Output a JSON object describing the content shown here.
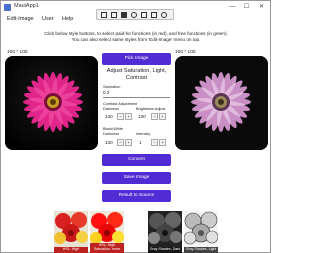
{
  "window": {
    "title": "MauiApp1",
    "controls": {
      "minimize": "—",
      "maximize": "☐",
      "close": "✕"
    }
  },
  "menu": [
    "Edit-Image",
    "User",
    "Help"
  ],
  "toolbar": {
    "icons": [
      "select-icon",
      "window-icon",
      "pointer-icon",
      "record-icon",
      "grid-icon",
      "inspect-icon",
      "settings-icon"
    ]
  },
  "instructions": "Click below style buttons, to select paid-for functions (in red), and free functions (in green). You can also select same styles from 'Edit-Image' menu on top.",
  "images": {
    "left_label": "100 * 100",
    "right_label": "100 * 100"
  },
  "controls": {
    "pick_image": "Pick Image",
    "heading": "Adjust Saturation, Light, Contrast",
    "saturation_label": "Saturation",
    "saturation_value": "0.2",
    "contrast_section": "Contrast Adjustment",
    "darkness_label": "Darkness",
    "brightness_label": "Brightness Adjust",
    "darkness_value": "130",
    "darkness_minus": "−",
    "darkness_plus": "+",
    "brightness_value": "130",
    "brightness_minus": "−",
    "brightness_plus": "+",
    "bw_section": "Black/White",
    "bw_darkness_label": "Darkness",
    "intensity_label": "Intensity",
    "bw_darkness_value": "130",
    "bw_darkness_minus": "−",
    "bw_darkness_plus": "+",
    "intensity_value": "1",
    "intensity_minus": "−",
    "intensity_plus": "+",
    "convert": "Convert",
    "save": "Save Image",
    "result": "Result to Source"
  },
  "thumbnails": [
    {
      "caption": "HSL: High"
    },
    {
      "caption": "HSL: High Saturation, more"
    },
    {
      "caption": "Gray Shades, Dark"
    },
    {
      "caption": "Gray Shades, Light"
    }
  ],
  "colors": {
    "accent": "#512bd4",
    "paid": "#b40000"
  }
}
